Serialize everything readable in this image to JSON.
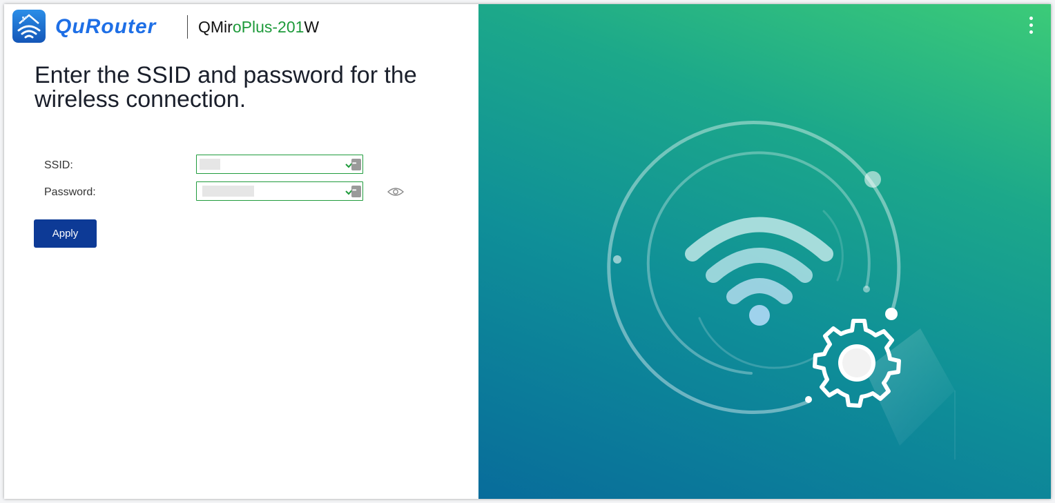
{
  "header": {
    "brand": "QuRouter",
    "device_name_part1": "QMir",
    "device_name_part2": "oPlus-201",
    "device_name_part3": "W"
  },
  "page": {
    "title": "Enter the SSID and password for the wireless connection."
  },
  "form": {
    "ssid_label": "SSID:",
    "ssid_value": "",
    "password_label": "Password:",
    "password_value": "",
    "apply_label": "Apply"
  },
  "colors": {
    "brand_blue": "#1e6fe6",
    "device_green": "#1d9a3a",
    "apply_button": "#0d3a96",
    "valid_border": "#1f9b3c",
    "panel_gradient_top": "#3ccb78",
    "panel_gradient_bottom": "#086c9b"
  },
  "icons": {
    "app": "qurouter-app-icon",
    "field_valid": "check-icon",
    "password_manager": "password-manager-icon",
    "show_password": "eye-icon",
    "menu": "more-vertical-icon",
    "illustration": "wifi-settings-illustration"
  }
}
